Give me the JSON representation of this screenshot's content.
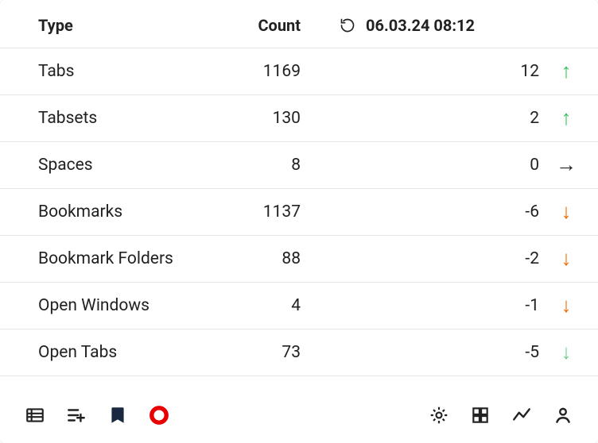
{
  "header": {
    "type_label": "Type",
    "count_label": "Count",
    "timestamp": "06.03.24 08:12"
  },
  "rows": [
    {
      "type": "Tabs",
      "count": "1169",
      "delta": "12",
      "trend": "up-green"
    },
    {
      "type": "Tabsets",
      "count": "130",
      "delta": "2",
      "trend": "up-green"
    },
    {
      "type": "Spaces",
      "count": "8",
      "delta": "0",
      "trend": "right"
    },
    {
      "type": "Bookmarks",
      "count": "1137",
      "delta": "-6",
      "trend": "down-orange"
    },
    {
      "type": "Bookmark Folders",
      "count": "88",
      "delta": "-2",
      "trend": "down-orange"
    },
    {
      "type": "Open Windows",
      "count": "4",
      "delta": "-1",
      "trend": "down-orange"
    },
    {
      "type": "Open Tabs",
      "count": "73",
      "delta": "-5",
      "trend": "down-green"
    }
  ]
}
